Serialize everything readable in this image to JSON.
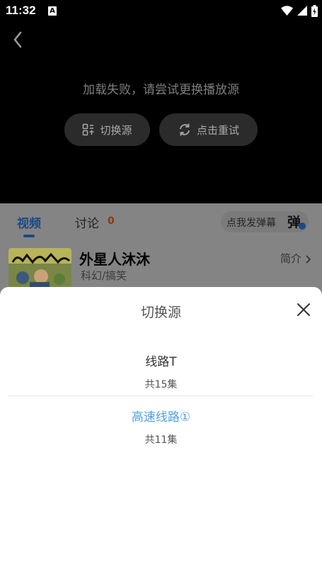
{
  "status_bar": {
    "time": "11:32",
    "notif_letter": "A"
  },
  "player": {
    "error_message": "加载失败，请尝试更换播放源",
    "switch_source_label": "切换源",
    "retry_label": "点击重试"
  },
  "tabs": {
    "video": "视频",
    "discuss": "讨论",
    "discuss_count": "0"
  },
  "danmaku": {
    "prompt": "点我发弹幕",
    "icon_char": "弹"
  },
  "show": {
    "title": "外星人沐沐",
    "genre": "科幻/搞笑",
    "intro_label": "简介"
  },
  "sheet": {
    "title": "切换源",
    "sources": [
      {
        "name": "线路T",
        "episodes": "共15集"
      },
      {
        "name": "高速线路①",
        "episodes": "共11集"
      }
    ]
  },
  "colors": {
    "accent": "#4fa0e8",
    "tab_active": "#1a4a86",
    "player_bg": "#000000"
  }
}
